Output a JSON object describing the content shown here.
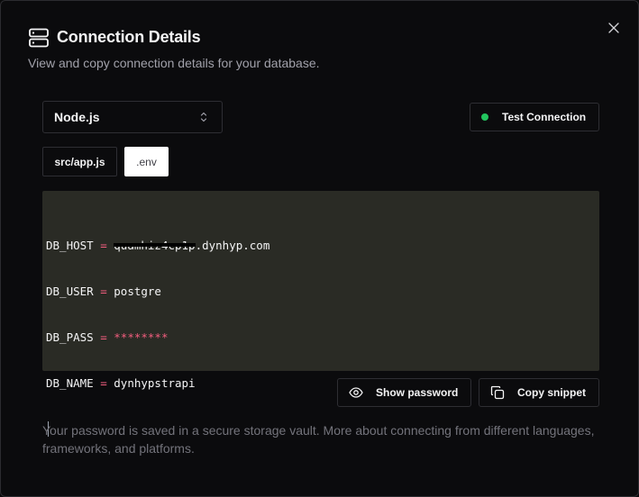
{
  "dialog": {
    "title": "Connection Details",
    "subtitle": "View and copy connection details for your database.",
    "header_icon": "server-icon",
    "close_icon": "close-icon"
  },
  "language_select": {
    "selected": "Node.js",
    "icon": "chevron-up-down-icon"
  },
  "test_connection": {
    "label": "Test Connection",
    "status_color": "#22c55e"
  },
  "tabs": [
    {
      "label": "src/app.js",
      "active": false
    },
    {
      "label": ".env",
      "active": true
    }
  ],
  "code": {
    "lines": [
      {
        "key": "DB_HOST",
        "op": " = ",
        "value_redacted": "quamhiz4cp1p",
        "value": ".dynhyp.com"
      },
      {
        "key": "DB_USER",
        "op": " = ",
        "value": "postgre"
      },
      {
        "key": "DB_PASS",
        "op": " = ",
        "value": "********"
      },
      {
        "key": "DB_NAME",
        "op": " = ",
        "value": "dynhypstrapi"
      }
    ],
    "background": "#2a2b25",
    "accent": "#f25d7e"
  },
  "actions": {
    "show_password": {
      "label": "Show password",
      "icon": "eye-icon"
    },
    "copy_snippet": {
      "label": "Copy snippet",
      "icon": "copy-icon"
    }
  },
  "footer": {
    "text": "Your password is saved in a secure storage vault. More about connecting from different languages, frameworks, and platforms."
  }
}
